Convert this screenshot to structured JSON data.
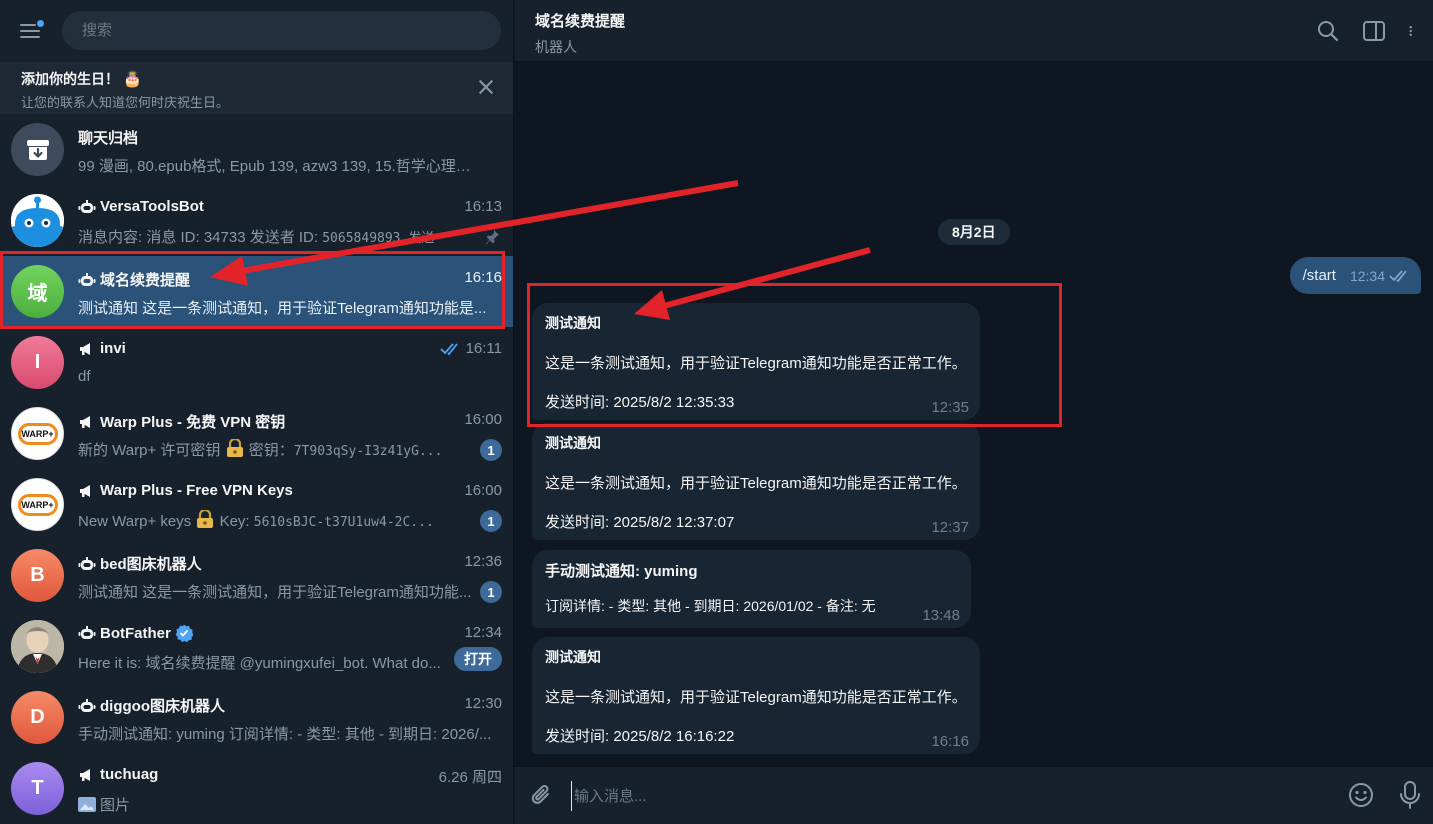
{
  "sidebar": {
    "search_placeholder": "搜索",
    "birthday": {
      "title": "添加你的生日！",
      "cake": "🎂",
      "subtitle": "让您的联系人知道您何时庆祝生日。"
    },
    "chats": [
      {
        "name": "聊天归档",
        "time": "",
        "preview": "99 漫画, 80.epub格式, Epub 139, azw3 139, 15.哲学心理学...",
        "avatar_color": "#3d4b5c",
        "icon": "archive-icon"
      },
      {
        "name": "VersaToolsBot",
        "time": "16:13",
        "preview_a": "消息内容: 消息 ID: 34733  发送者 ID: ",
        "preview_mono": "5065849893 发送",
        "icon": "bot-icon",
        "pinned": true
      },
      {
        "name": "域名续费提醒",
        "time": "16:16",
        "preview": "测试通知  这是一条测试通知，用于验证Telegram通知功能是...",
        "avatar_letter": "域",
        "avatar_color": "#5cb94b",
        "icon": "bot-icon",
        "active": true
      },
      {
        "name": "invi",
        "time": "16:11",
        "preview": "df",
        "avatar_letter": "I",
        "avatar_color": "#e05479",
        "icon": "megaphone-icon",
        "read": true
      },
      {
        "name": "Warp Plus - 免费 VPN 密钥",
        "time": "16:00",
        "preview_a": "新的 Warp+ 许可密钥 ",
        "preview_b": " 密钥：",
        "preview_mono": "7T903qSy-I3z41yG...",
        "badge": "1",
        "avatar_logo": "WARP+",
        "icon": "megaphone-icon"
      },
      {
        "name": "Warp Plus - Free VPN Keys",
        "time": "16:00",
        "preview_a": "New Warp+ keys ",
        "preview_b": " Key: ",
        "preview_mono": "5610sBJC-t37U1uw4-2C...",
        "badge": "1",
        "avatar_logo": "WARP+",
        "icon": "megaphone-icon"
      },
      {
        "name": "bed图床机器人",
        "time": "12:36",
        "preview": "测试通知  这是一条测试通知，用于验证Telegram通知功能...",
        "badge": "1",
        "avatar_letter": "B",
        "avatar_color": "#e8684a",
        "icon": "bot-icon"
      },
      {
        "name": "BotFather",
        "time": "12:34",
        "preview": "Here it is: 域名续费提醒 @yumingxufei_bot. What do...",
        "open_label": "打开",
        "icon": "bot-icon",
        "verified": true
      },
      {
        "name": "diggoo图床机器人",
        "time": "12:30",
        "preview": "手动测试通知: yuming  订阅详情: - 类型: 其他 - 到期日: 2026/...",
        "avatar_letter": "D",
        "avatar_color": "#e8684a",
        "icon": "bot-icon"
      },
      {
        "name": "tuchuag",
        "time": "6.26 周四",
        "preview": "图片",
        "avatar_letter": "T",
        "avatar_color": "#8e6ee0",
        "icon": "megaphone-icon"
      }
    ]
  },
  "header": {
    "title": "域名续费提醒",
    "subtitle": "机器人"
  },
  "messages": {
    "date": "8月2日",
    "outgoing": {
      "text": "/start",
      "time": "12:34"
    },
    "incoming": [
      {
        "title": "测试通知",
        "body": "这是一条测试通知，用于验证Telegram通知功能是否正常工作。",
        "sent": "发送时间: 2025/8/2 12:35:33",
        "time": "12:35"
      },
      {
        "title": "测试通知",
        "body": "这是一条测试通知，用于验证Telegram通知功能是否正常工作。",
        "sent": "发送时间: 2025/8/2 12:37:07",
        "time": "12:37"
      },
      {
        "title": "手动测试通知: yuming",
        "body": "订阅详情: - 类型: 其他 - 到期日: 2026/01/02 - 备注: 无",
        "sent": "",
        "time": "13:48"
      },
      {
        "title": "测试通知",
        "body": "这是一条测试通知，用于验证Telegram通知功能是否正常工作。",
        "sent": "发送时间: 2025/8/2 16:16:22",
        "time": "16:16"
      }
    ]
  },
  "composer": {
    "placeholder": "输入消息..."
  },
  "colors": {
    "accent": "#2b5278",
    "annotation_red": "#e3232a",
    "badge": "#3e6a99"
  }
}
